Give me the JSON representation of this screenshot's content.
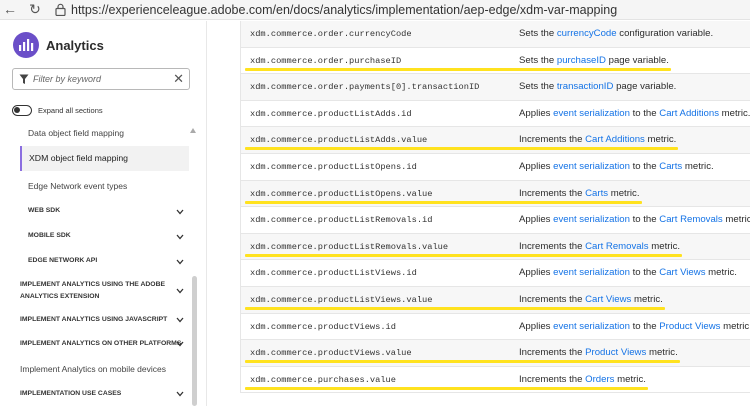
{
  "browser": {
    "url": "https://experienceleague.adobe.com/en/docs/analytics/implementation/aep-edge/xdm-var-mapping",
    "back_glyph": "←",
    "reload_glyph": "↻"
  },
  "sidebar": {
    "app_title": "Analytics",
    "filter_placeholder": "Filter by keyword",
    "clear_glyph": "✕",
    "expand_all_label": "Expand all sections",
    "items": [
      {
        "label": "Data object field mapping"
      },
      {
        "label": "XDM object field mapping",
        "active": true
      },
      {
        "label": "Edge Network event types"
      },
      {
        "label": "WEB SDK"
      },
      {
        "label": "MOBILE SDK"
      },
      {
        "label": "EDGE NETWORK API"
      },
      {
        "label": "IMPLEMENT ANALYTICS USING THE ADOBE",
        "label2": "ANALYTICS EXTENSION"
      },
      {
        "label": "IMPLEMENT ANALYTICS USING JAVASCRIPT"
      },
      {
        "label": "IMPLEMENT ANALYTICS ON OTHER PLATFORMS"
      },
      {
        "label": "Implement Analytics on mobile devices"
      },
      {
        "label": "IMPLEMENTATION USE CASES"
      }
    ]
  },
  "table": {
    "rows": [
      {
        "field": "xdm.commerce.order.currencyCode",
        "pre": "Sets the ",
        "link": "currencyCode",
        "post": " configuration variable."
      },
      {
        "field": "xdm.commerce.order.purchaseID",
        "pre": "Sets the ",
        "link": "purchaseID",
        "post": " page variable."
      },
      {
        "field": "xdm.commerce.order.payments[0].transactionID",
        "pre": "Sets the ",
        "link": "transactionID",
        "post": " page variable."
      },
      {
        "field": "xdm.commerce.productListAdds.id",
        "pre": "Applies ",
        "link": "event serialization",
        "mid": " to the ",
        "link2": "Cart Additions",
        "post": " metric."
      },
      {
        "field": "xdm.commerce.productListAdds.value",
        "pre": "Increments the ",
        "link": "Cart Additions",
        "post": " metric."
      },
      {
        "field": "xdm.commerce.productListOpens.id",
        "pre": "Applies ",
        "link": "event serialization",
        "mid": " to the ",
        "link2": "Carts",
        "post": " metric."
      },
      {
        "field": "xdm.commerce.productListOpens.value",
        "pre": "Increments the ",
        "link": "Carts",
        "post": " metric."
      },
      {
        "field": "xdm.commerce.productListRemovals.id",
        "pre": "Applies ",
        "link": "event serialization",
        "mid": " to the ",
        "link2": "Cart Removals",
        "post": " metric."
      },
      {
        "field": "xdm.commerce.productListRemovals.value",
        "pre": "Increments the ",
        "link": "Cart Removals",
        "post": " metric."
      },
      {
        "field": "xdm.commerce.productListViews.id",
        "pre": "Applies ",
        "link": "event serialization",
        "mid": " to the ",
        "link2": "Cart Views",
        "post": " metric."
      },
      {
        "field": "xdm.commerce.productListViews.value",
        "pre": "Increments the ",
        "link": "Cart Views",
        "post": " metric."
      },
      {
        "field": "xdm.commerce.productViews.id",
        "pre": "Applies ",
        "link": "event serialization",
        "mid": " to the ",
        "link2": "Product Views",
        "post": " metric."
      },
      {
        "field": "xdm.commerce.productViews.value",
        "pre": "Increments the ",
        "link": "Product Views",
        "post": " metric."
      },
      {
        "field": "xdm.commerce.purchases.value",
        "pre": "Increments the ",
        "link": "Orders",
        "post": " metric."
      }
    ]
  },
  "colors": {
    "link": "#1473e6",
    "highlight": "#ffe21f",
    "brand": "#6b4fc8",
    "active_nav": "#8b6ee0"
  }
}
